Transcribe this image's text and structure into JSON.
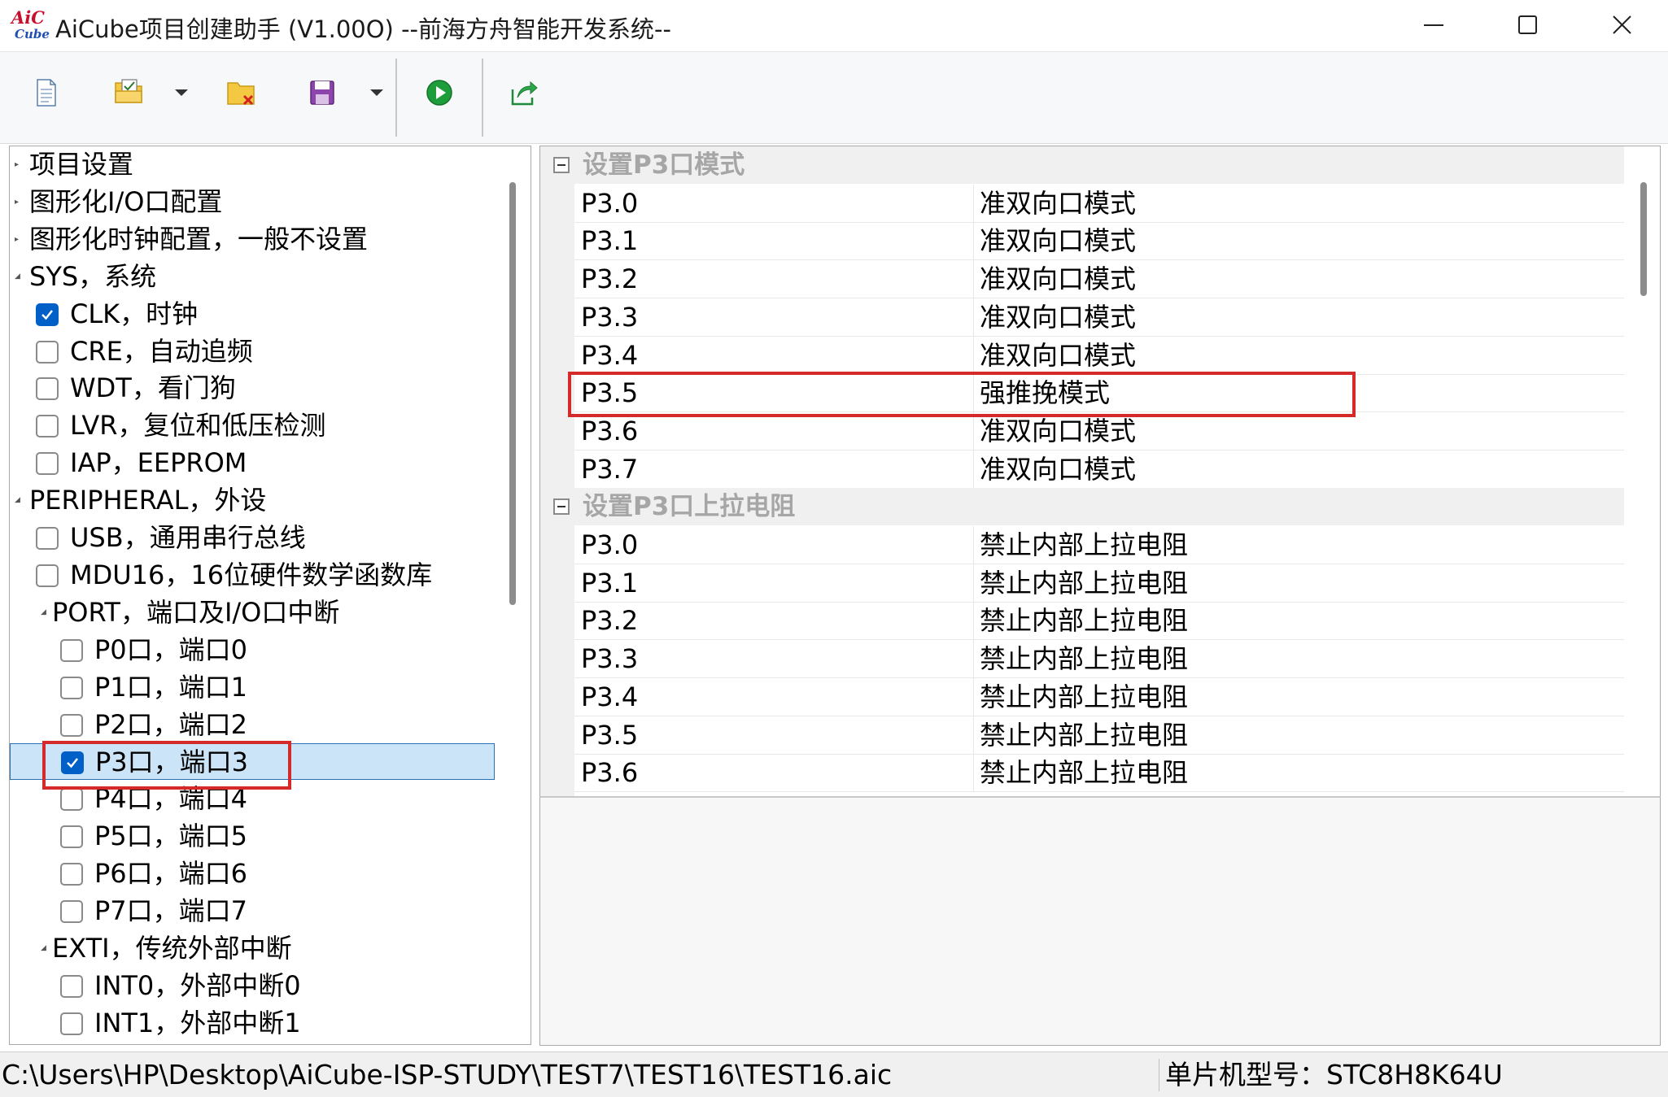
{
  "window": {
    "logo_top": "AiC",
    "logo_bottom": "Cube",
    "title": "AiCube项目创建助手 (V1.00O) --前海方舟智能开发系统--"
  },
  "toolbar": {
    "icons": [
      "new-file-icon",
      "open-project-icon",
      "dropdown-arrow-icon",
      "close-project-icon",
      "save-icon",
      "dropdown-arrow-icon",
      "run-icon",
      "export-icon"
    ]
  },
  "tree": {
    "items": [
      {
        "label": "项目设置",
        "has_checkbox": false
      },
      {
        "label": "图形化I/O口配置",
        "has_checkbox": false
      },
      {
        "label": "图形化时钟配置，一般不设置",
        "has_checkbox": false
      },
      {
        "label": "SYS，系统",
        "has_checkbox": false,
        "expanded": true
      },
      {
        "label": "CLK，时钟",
        "has_checkbox": true,
        "checked": true
      },
      {
        "label": "CRE，自动追频",
        "has_checkbox": true,
        "checked": false
      },
      {
        "label": "WDT，看门狗",
        "has_checkbox": true,
        "checked": false
      },
      {
        "label": "LVR，复位和低压检测",
        "has_checkbox": true,
        "checked": false
      },
      {
        "label": "IAP，EEPROM",
        "has_checkbox": true,
        "checked": false
      },
      {
        "label": "PERIPHERAL，外设",
        "has_checkbox": false,
        "expanded": true
      },
      {
        "label": "USB，通用串行总线",
        "has_checkbox": true,
        "checked": false
      },
      {
        "label": "MDU16，16位硬件数学函数库",
        "has_checkbox": true,
        "checked": false
      },
      {
        "label": "PORT，端口及I/O口中断",
        "has_checkbox": false,
        "expanded": true
      },
      {
        "label": "P0口，端口0",
        "has_checkbox": true,
        "checked": false
      },
      {
        "label": "P1口，端口1",
        "has_checkbox": true,
        "checked": false
      },
      {
        "label": "P2口，端口2",
        "has_checkbox": true,
        "checked": false
      },
      {
        "label": "P3口，端口3",
        "has_checkbox": true,
        "checked": true,
        "selected": true
      },
      {
        "label": "P4口，端口4",
        "has_checkbox": true,
        "checked": false
      },
      {
        "label": "P5口，端口5",
        "has_checkbox": true,
        "checked": false
      },
      {
        "label": "P6口，端口6",
        "has_checkbox": true,
        "checked": false
      },
      {
        "label": "P7口，端口7",
        "has_checkbox": true,
        "checked": false
      },
      {
        "label": "EXTI，传统外部中断",
        "has_checkbox": false,
        "expanded": true
      },
      {
        "label": "INT0，外部中断0",
        "has_checkbox": true,
        "checked": false
      },
      {
        "label": "INT1，外部中断1",
        "has_checkbox": true,
        "checked": false
      }
    ]
  },
  "properties": {
    "categories": [
      {
        "title": "设置P3口模式",
        "rows": [
          {
            "name": "P3.0",
            "value": "准双向口模式"
          },
          {
            "name": "P3.1",
            "value": "准双向口模式"
          },
          {
            "name": "P3.2",
            "value": "准双向口模式"
          },
          {
            "name": "P3.3",
            "value": "准双向口模式"
          },
          {
            "name": "P3.4",
            "value": "准双向口模式"
          },
          {
            "name": "P3.5",
            "value": "强推挽模式"
          },
          {
            "name": "P3.6",
            "value": "准双向口模式"
          },
          {
            "name": "P3.7",
            "value": "准双向口模式"
          }
        ]
      },
      {
        "title": "设置P3口上拉电阻",
        "rows": [
          {
            "name": "P3.0",
            "value": "禁止内部上拉电阻"
          },
          {
            "name": "P3.1",
            "value": "禁止内部上拉电阻"
          },
          {
            "name": "P3.2",
            "value": "禁止内部上拉电阻"
          },
          {
            "name": "P3.3",
            "value": "禁止内部上拉电阻"
          },
          {
            "name": "P3.4",
            "value": "禁止内部上拉电阻"
          },
          {
            "name": "P3.5",
            "value": "禁止内部上拉电阻"
          },
          {
            "name": "P3.6",
            "value": "禁止内部上拉电阻"
          }
        ]
      }
    ]
  },
  "status": {
    "path": "C:\\Users\\HP\\Desktop\\AiCube-ISP-STUDY\\TEST7\\TEST16\\TEST16.aic",
    "chip": "单片机型号：STC8H8K64U"
  },
  "colors": {
    "highlight": "#d42a2a",
    "checkbox_checked": "#0060c8",
    "selected_row": "#cce4f7"
  }
}
